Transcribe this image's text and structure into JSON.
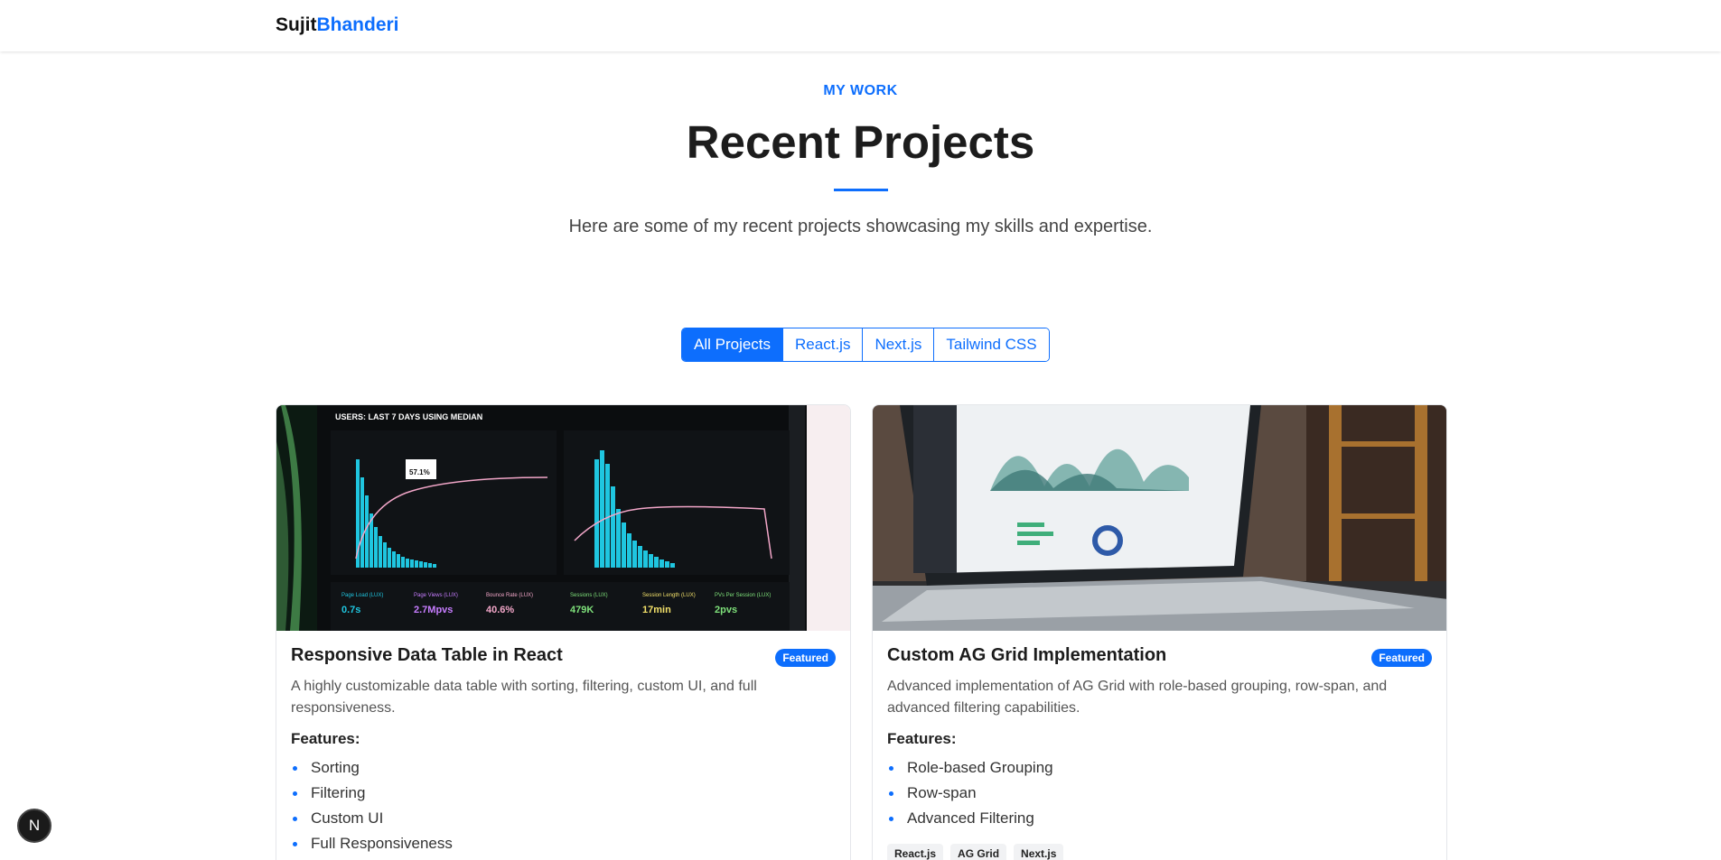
{
  "nav": {
    "brand_first": "Sujit",
    "brand_last": "Bhanderi"
  },
  "section": {
    "label": "MY WORK",
    "title": "Recent Projects",
    "subtitle": "Here are some of my recent projects showcasing my skills and expertise."
  },
  "filters": [
    {
      "label": "All Projects",
      "active": true
    },
    {
      "label": "React.js",
      "active": false
    },
    {
      "label": "Next.js",
      "active": false
    },
    {
      "label": "Tailwind CSS",
      "active": false
    }
  ],
  "projects": [
    {
      "title": "Responsive Data Table in React",
      "badge": "Featured",
      "description": "A highly customizable data table with sorting, filtering, custom UI, and full responsiveness.",
      "features_heading": "Features:",
      "features": [
        "Sorting",
        "Filtering",
        "Custom UI",
        "Full Responsiveness"
      ],
      "tags": [],
      "image": {
        "header": "USERS: LAST 7 DAYS USING MEDIAN",
        "metric_labels": [
          "Page Load (LUX)",
          "Page Views (LUX)",
          "Bounce Rate (LUX)",
          "Sessions (LUX)",
          "Session Length (LUX)",
          "PVs Per Session (LUX)"
        ],
        "metric_values": [
          "0.7s",
          "2.7Mpvs",
          "40.6%",
          "479K",
          "17min",
          "2pvs"
        ],
        "tooltip": "57.1%"
      }
    },
    {
      "title": "Custom AG Grid Implementation",
      "badge": "Featured",
      "description": "Advanced implementation of AG Grid with role-based grouping, row-span, and advanced filtering capabilities.",
      "features_heading": "Features:",
      "features": [
        "Role-based Grouping",
        "Row-span",
        "Advanced Filtering"
      ],
      "tags": [
        "React.js",
        "AG Grid",
        "Next.js"
      ]
    }
  ],
  "next_indicator": "N",
  "colors": {
    "accent": "#0d6efd",
    "chart_cyan": "#1fc6e0",
    "chart_pink": "#f2a6c8"
  }
}
